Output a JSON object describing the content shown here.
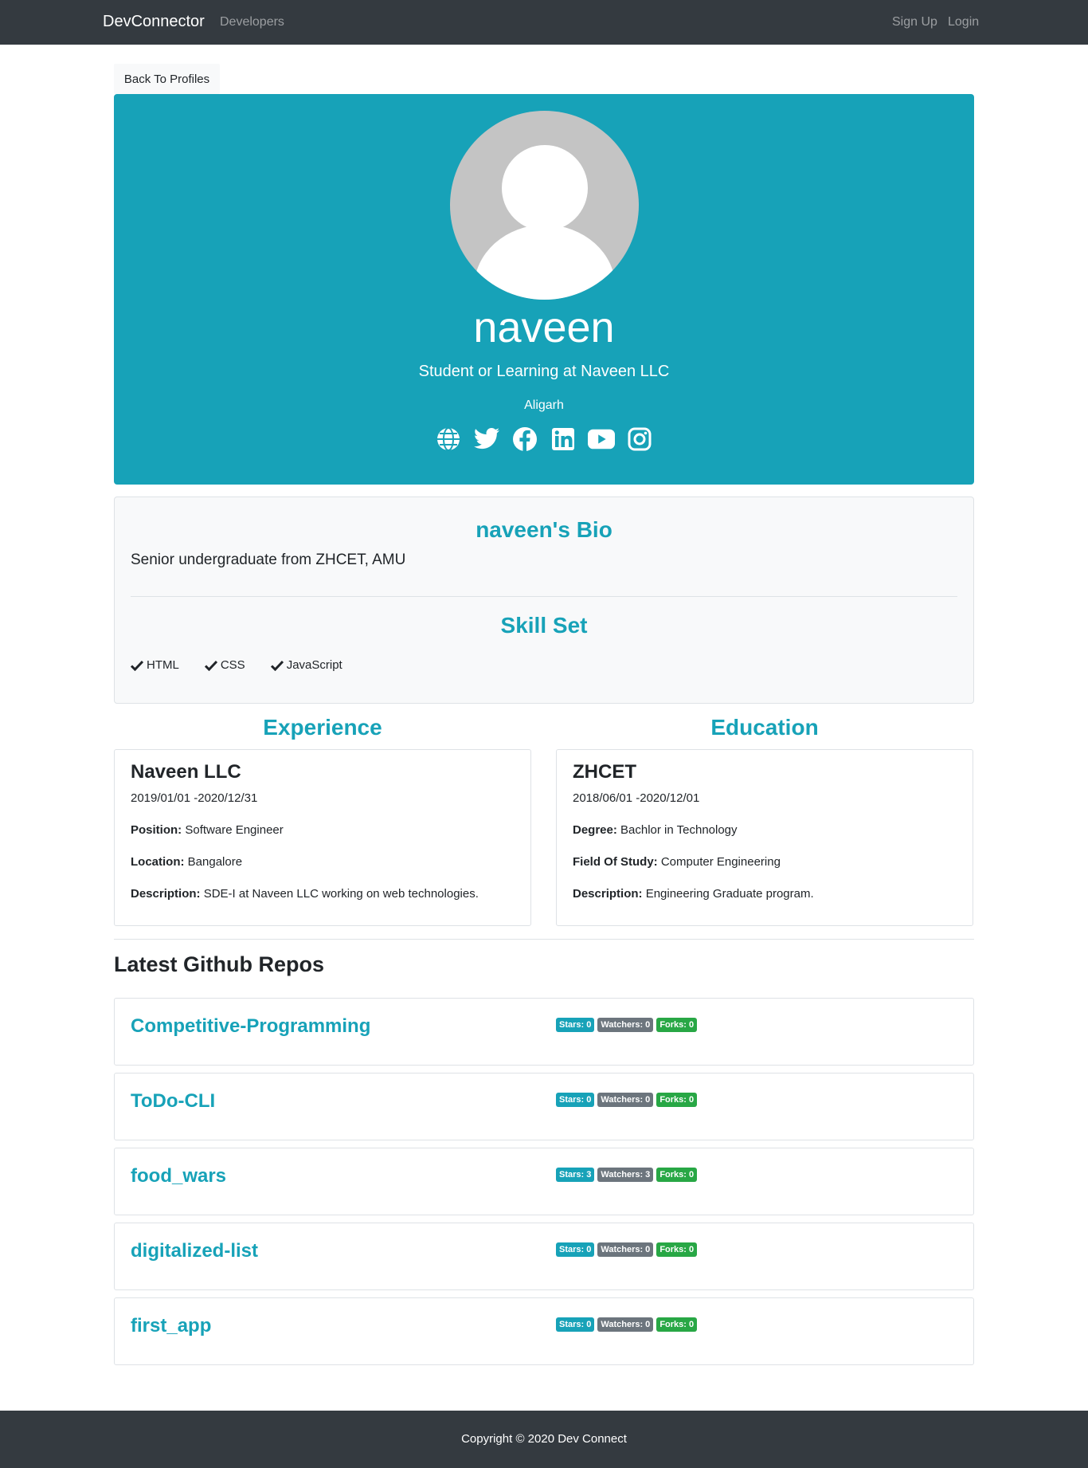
{
  "nav": {
    "brand": "DevConnector",
    "developers": "Developers",
    "signup": "Sign Up",
    "login": "Login"
  },
  "back_button": "Back To Profiles",
  "profile": {
    "name": "naveen",
    "status": "Student or Learning at Naveen LLC",
    "location": "Aligarh",
    "social_icons": [
      "globe-icon",
      "twitter-icon",
      "facebook-icon",
      "linkedin-icon",
      "youtube-icon",
      "instagram-icon"
    ]
  },
  "bio": {
    "title": "naveen's Bio",
    "text": "Senior undergraduate from ZHCET, AMU",
    "skills_title": "Skill Set",
    "skills": [
      "HTML",
      "CSS",
      "JavaScript"
    ]
  },
  "experience": {
    "title": "Experience",
    "company": "Naveen LLC",
    "dates": "2019/01/01 -2020/12/31",
    "position_label": "Position:",
    "position": "Software Engineer",
    "location_label": "Location:",
    "location": "Bangalore",
    "description_label": "Description:",
    "description": "SDE-I at Naveen LLC working on web technologies."
  },
  "education": {
    "title": "Education",
    "school": "ZHCET",
    "dates": "2018/06/01 -2020/12/01",
    "degree_label": "Degree:",
    "degree": "Bachlor in Technology",
    "field_label": "Field Of Study:",
    "field": "Computer Engineering",
    "description_label": "Description:",
    "description": "Engineering Graduate program."
  },
  "repos_heading": "Latest Github Repos",
  "repos": [
    {
      "name": "Competitive-Programming",
      "stars": "Stars: 0",
      "watchers": "Watchers: 0",
      "forks": "Forks: 0"
    },
    {
      "name": "ToDo-CLI",
      "stars": "Stars: 0",
      "watchers": "Watchers: 0",
      "forks": "Forks: 0"
    },
    {
      "name": "food_wars",
      "stars": "Stars: 3",
      "watchers": "Watchers: 3",
      "forks": "Forks: 0"
    },
    {
      "name": "digitalized-list",
      "stars": "Stars: 0",
      "watchers": "Watchers: 0",
      "forks": "Forks: 0"
    },
    {
      "name": "first_app",
      "stars": "Stars: 0",
      "watchers": "Watchers: 0",
      "forks": "Forks: 0"
    }
  ],
  "footer": "Copyright © 2020 Dev Connect",
  "colors": {
    "navbar": "#343a40",
    "primary": "#17a2b8",
    "light": "#f8f9fa",
    "secondary": "#6c757d",
    "success": "#28a745"
  }
}
